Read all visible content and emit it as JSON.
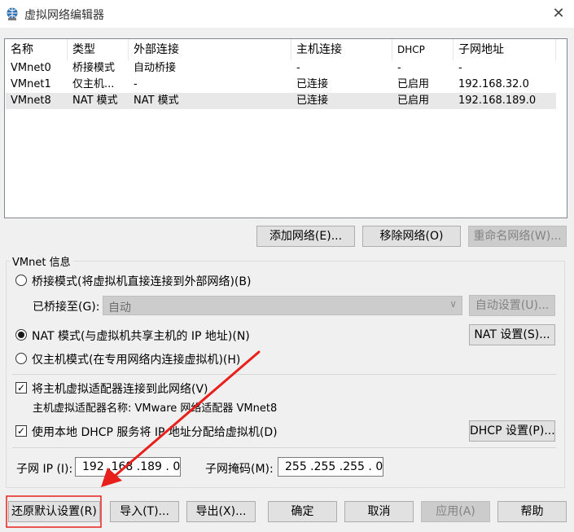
{
  "window": {
    "title": "虚拟网络编辑器",
    "close_glyph": "✕"
  },
  "table": {
    "headers": [
      "名称",
      "类型",
      "外部连接",
      "主机连接",
      "DHCP",
      "子网地址"
    ],
    "rows": [
      [
        "VMnet0",
        "桥接模式",
        "自动桥接",
        "-",
        "-",
        "-"
      ],
      [
        "VMnet1",
        "仅主机...",
        "-",
        "已连接",
        "已启用",
        "192.168.32.0"
      ],
      [
        "VMnet8",
        "NAT 模式",
        "NAT 模式",
        "已连接",
        "已启用",
        "192.168.189.0"
      ]
    ],
    "selected_row": 2
  },
  "list_buttons": {
    "add": "添加网络(E)...",
    "remove": "移除网络(O)",
    "rename": "重命名网络(W)..."
  },
  "vmnet_info": {
    "group_title": "VMnet 信息",
    "bridge_mode": "桥接模式(将虚拟机直接连接到外部网络)(B)",
    "bridged_to_label": "已桥接至(G):",
    "bridged_to_value": "自动",
    "auto_settings": "自动设置(U)...",
    "nat_mode": "NAT 模式(与虚拟机共享主机的 IP 地址)(N)",
    "nat_settings": "NAT 设置(S)...",
    "host_only_mode": "仅主机模式(在专用网络内连接虚拟机)(H)",
    "selected_mode": "nat",
    "connect_adapter": "将主机虚拟适配器连接到此网络(V)",
    "adapter_name": "主机虚拟适配器名称: VMware 网络适配器 VMnet8",
    "use_dhcp": "使用本地 DHCP 服务将 IP 地址分配给虚拟机(D)",
    "dhcp_settings": "DHCP 设置(P)...",
    "subnet_ip_label": "子网 IP (I):",
    "subnet_ip_value": "192 .168 .189 . 0",
    "subnet_mask_label": "子网掩码(M):",
    "subnet_mask_value": "255 .255 .255 . 0"
  },
  "footer_buttons": {
    "restore": "还原默认设置(R)",
    "import": "导入(T)...",
    "export": "导出(X)...",
    "ok": "确定",
    "cancel": "取消",
    "apply": "应用(A)",
    "help": "帮助"
  },
  "colors": {
    "annotation": "#e8201c",
    "selection": "#e8e8e8"
  }
}
